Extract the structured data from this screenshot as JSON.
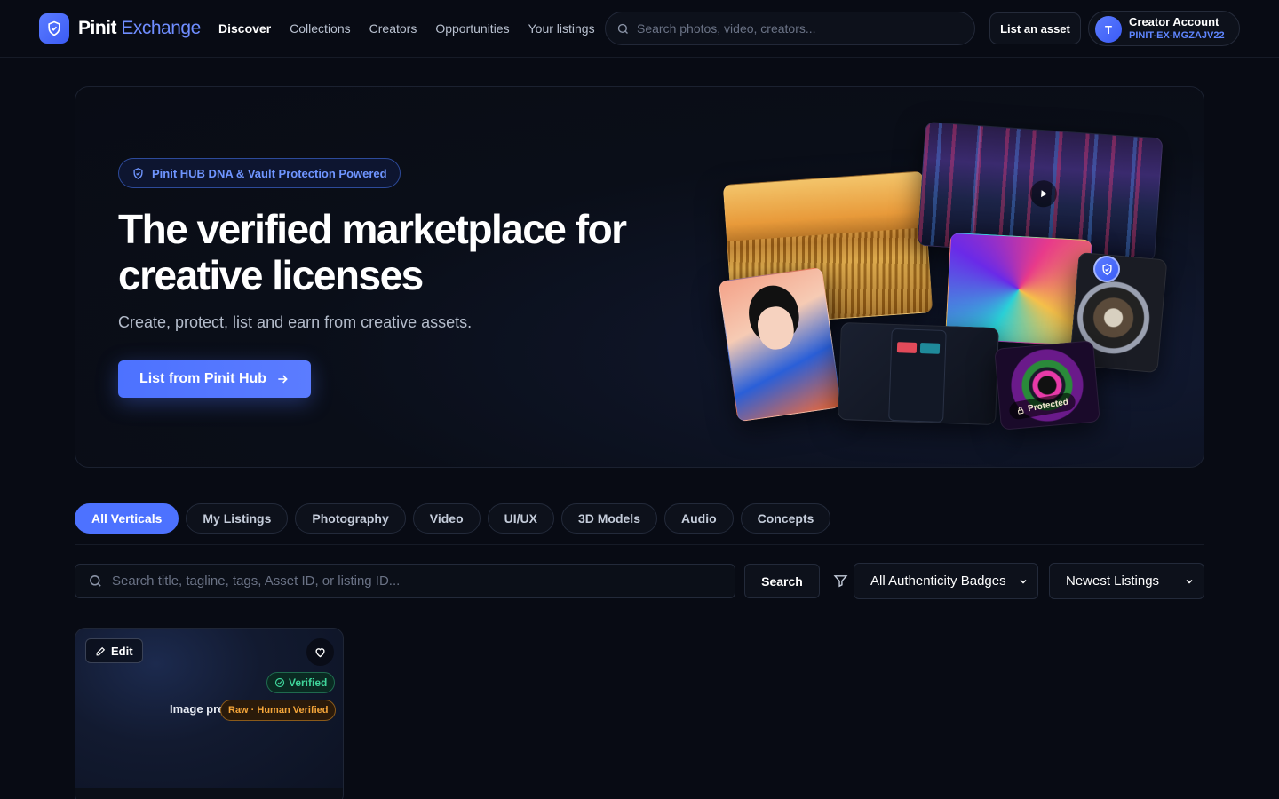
{
  "header": {
    "brand_name": "Pinit",
    "brand_accent": "Exchange",
    "nav": [
      "Discover",
      "Collections",
      "Creators",
      "Opportunities",
      "Your listings"
    ],
    "search_placeholder": "Search photos, video, creators...",
    "list_asset_label": "List an asset",
    "account": {
      "avatar_initial": "T",
      "name": "Creator Account",
      "id": "PINIT-EX-MGZAJV22"
    }
  },
  "hero": {
    "badge": "Pinit HUB DNA & Vault Protection Powered",
    "title": "The verified marketplace for creative licenses",
    "subtitle": "Create, protect, list and earn from creative assets.",
    "cta": "List from Pinit Hub",
    "collage_tag": "Protected"
  },
  "filters": {
    "verticals": [
      "All Verticals",
      "My Listings",
      "Photography",
      "Video",
      "UI/UX",
      "3D Models",
      "Audio",
      "Concepts"
    ],
    "active_vertical": "All Verticals",
    "search_placeholder": "Search title, tagline, tags, Asset ID, or listing ID...",
    "search_button": "Search",
    "badge_select": "All Authenticity Badges",
    "sort_select": "Newest Listings"
  },
  "listing_card": {
    "edit_label": "Edit",
    "verified_label": "Verified",
    "preview_label": "Image preview",
    "human_badge": "Raw · Human Verified"
  },
  "colors": {
    "accent": "#4d72ff",
    "background": "#080b14",
    "verified": "#3fd49a",
    "human_verified": "#f5a63a"
  }
}
